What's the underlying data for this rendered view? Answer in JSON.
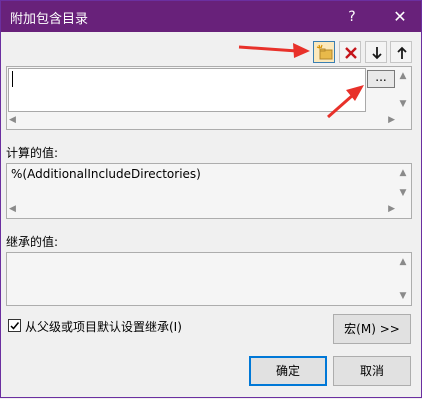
{
  "dialog": {
    "title": "附加包含目录",
    "help_glyph": "?",
    "close_glyph": "✕"
  },
  "toolbar": {
    "new_line_icon": "new-line-icon",
    "delete_icon": "delete-icon",
    "move_down_icon": "move-down-icon",
    "move_up_icon": "move-up-icon"
  },
  "editor": {
    "value": "",
    "browse_label": "..."
  },
  "computed": {
    "label": "计算的值:",
    "value": "%(AdditionalIncludeDirectories)"
  },
  "inherited": {
    "label": "继承的值:"
  },
  "inherit_checkbox": {
    "label": "从父级或项目默认设置继承(I)",
    "checked": true
  },
  "buttons": {
    "macro": "宏(M) >>",
    "ok": "确定",
    "cancel": "取消"
  },
  "colors": {
    "titlebar": "#68217a",
    "annotation_arrow": "#e8312a",
    "default_button_border": "#0078d7"
  }
}
